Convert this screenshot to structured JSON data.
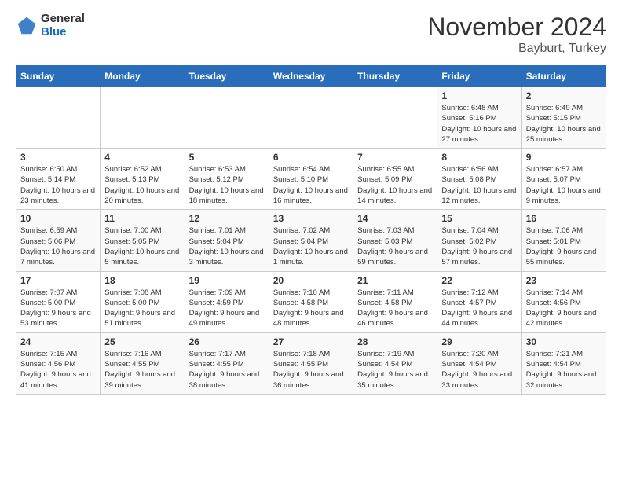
{
  "logo": {
    "general": "General",
    "blue": "Blue"
  },
  "title": "November 2024",
  "subtitle": "Bayburt, Turkey",
  "headers": [
    "Sunday",
    "Monday",
    "Tuesday",
    "Wednesday",
    "Thursday",
    "Friday",
    "Saturday"
  ],
  "rows": [
    [
      {
        "day": "",
        "info": ""
      },
      {
        "day": "",
        "info": ""
      },
      {
        "day": "",
        "info": ""
      },
      {
        "day": "",
        "info": ""
      },
      {
        "day": "",
        "info": ""
      },
      {
        "day": "1",
        "info": "Sunrise: 6:48 AM\nSunset: 5:16 PM\nDaylight: 10 hours and 27 minutes."
      },
      {
        "day": "2",
        "info": "Sunrise: 6:49 AM\nSunset: 5:15 PM\nDaylight: 10 hours and 25 minutes."
      }
    ],
    [
      {
        "day": "3",
        "info": "Sunrise: 6:50 AM\nSunset: 5:14 PM\nDaylight: 10 hours and 23 minutes."
      },
      {
        "day": "4",
        "info": "Sunrise: 6:52 AM\nSunset: 5:13 PM\nDaylight: 10 hours and 20 minutes."
      },
      {
        "day": "5",
        "info": "Sunrise: 6:53 AM\nSunset: 5:12 PM\nDaylight: 10 hours and 18 minutes."
      },
      {
        "day": "6",
        "info": "Sunrise: 6:54 AM\nSunset: 5:10 PM\nDaylight: 10 hours and 16 minutes."
      },
      {
        "day": "7",
        "info": "Sunrise: 6:55 AM\nSunset: 5:09 PM\nDaylight: 10 hours and 14 minutes."
      },
      {
        "day": "8",
        "info": "Sunrise: 6:56 AM\nSunset: 5:08 PM\nDaylight: 10 hours and 12 minutes."
      },
      {
        "day": "9",
        "info": "Sunrise: 6:57 AM\nSunset: 5:07 PM\nDaylight: 10 hours and 9 minutes."
      }
    ],
    [
      {
        "day": "10",
        "info": "Sunrise: 6:59 AM\nSunset: 5:06 PM\nDaylight: 10 hours and 7 minutes."
      },
      {
        "day": "11",
        "info": "Sunrise: 7:00 AM\nSunset: 5:05 PM\nDaylight: 10 hours and 5 minutes."
      },
      {
        "day": "12",
        "info": "Sunrise: 7:01 AM\nSunset: 5:04 PM\nDaylight: 10 hours and 3 minutes."
      },
      {
        "day": "13",
        "info": "Sunrise: 7:02 AM\nSunset: 5:04 PM\nDaylight: 10 hours and 1 minute."
      },
      {
        "day": "14",
        "info": "Sunrise: 7:03 AM\nSunset: 5:03 PM\nDaylight: 9 hours and 59 minutes."
      },
      {
        "day": "15",
        "info": "Sunrise: 7:04 AM\nSunset: 5:02 PM\nDaylight: 9 hours and 57 minutes."
      },
      {
        "day": "16",
        "info": "Sunrise: 7:06 AM\nSunset: 5:01 PM\nDaylight: 9 hours and 55 minutes."
      }
    ],
    [
      {
        "day": "17",
        "info": "Sunrise: 7:07 AM\nSunset: 5:00 PM\nDaylight: 9 hours and 53 minutes."
      },
      {
        "day": "18",
        "info": "Sunrise: 7:08 AM\nSunset: 5:00 PM\nDaylight: 9 hours and 51 minutes."
      },
      {
        "day": "19",
        "info": "Sunrise: 7:09 AM\nSunset: 4:59 PM\nDaylight: 9 hours and 49 minutes."
      },
      {
        "day": "20",
        "info": "Sunrise: 7:10 AM\nSunset: 4:58 PM\nDaylight: 9 hours and 48 minutes."
      },
      {
        "day": "21",
        "info": "Sunrise: 7:11 AM\nSunset: 4:58 PM\nDaylight: 9 hours and 46 minutes."
      },
      {
        "day": "22",
        "info": "Sunrise: 7:12 AM\nSunset: 4:57 PM\nDaylight: 9 hours and 44 minutes."
      },
      {
        "day": "23",
        "info": "Sunrise: 7:14 AM\nSunset: 4:56 PM\nDaylight: 9 hours and 42 minutes."
      }
    ],
    [
      {
        "day": "24",
        "info": "Sunrise: 7:15 AM\nSunset: 4:56 PM\nDaylight: 9 hours and 41 minutes."
      },
      {
        "day": "25",
        "info": "Sunrise: 7:16 AM\nSunset: 4:55 PM\nDaylight: 9 hours and 39 minutes."
      },
      {
        "day": "26",
        "info": "Sunrise: 7:17 AM\nSunset: 4:55 PM\nDaylight: 9 hours and 38 minutes."
      },
      {
        "day": "27",
        "info": "Sunrise: 7:18 AM\nSunset: 4:55 PM\nDaylight: 9 hours and 36 minutes."
      },
      {
        "day": "28",
        "info": "Sunrise: 7:19 AM\nSunset: 4:54 PM\nDaylight: 9 hours and 35 minutes."
      },
      {
        "day": "29",
        "info": "Sunrise: 7:20 AM\nSunset: 4:54 PM\nDaylight: 9 hours and 33 minutes."
      },
      {
        "day": "30",
        "info": "Sunrise: 7:21 AM\nSunset: 4:54 PM\nDaylight: 9 hours and 32 minutes."
      }
    ]
  ]
}
